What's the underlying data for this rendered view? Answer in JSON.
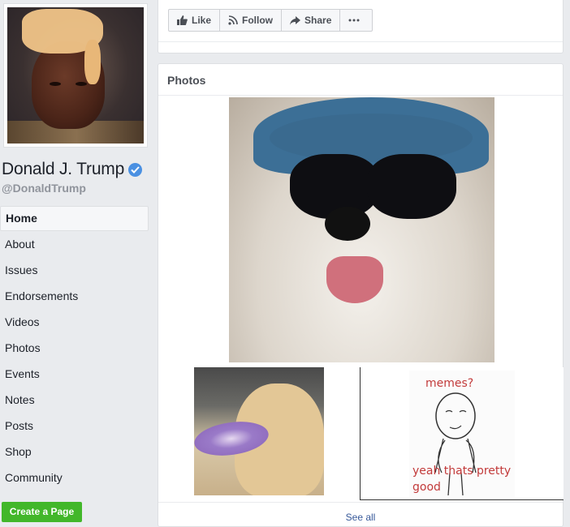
{
  "profile": {
    "name": "Donald J. Trump",
    "handle": "@DonaldTrump",
    "verified": true,
    "verified_color": "#4a90e2"
  },
  "nav": {
    "items": [
      {
        "label": "Home",
        "active": true
      },
      {
        "label": "About"
      },
      {
        "label": "Issues"
      },
      {
        "label": "Endorsements"
      },
      {
        "label": "Videos"
      },
      {
        "label": "Photos"
      },
      {
        "label": "Events"
      },
      {
        "label": "Notes"
      },
      {
        "label": "Posts"
      },
      {
        "label": "Shop"
      },
      {
        "label": "Community"
      }
    ]
  },
  "create_page_label": "Create a Page",
  "create_page_color": "#42b72a",
  "actions": {
    "like": "Like",
    "follow": "Follow",
    "share": "Share",
    "more_icon": "more-icon"
  },
  "photos": {
    "title": "Photos",
    "meme_top": "memes?",
    "meme_bottom": "yeah thats pretty good",
    "see_all": "See all"
  },
  "colors": {
    "link": "#365899",
    "background": "#e9ebee"
  }
}
